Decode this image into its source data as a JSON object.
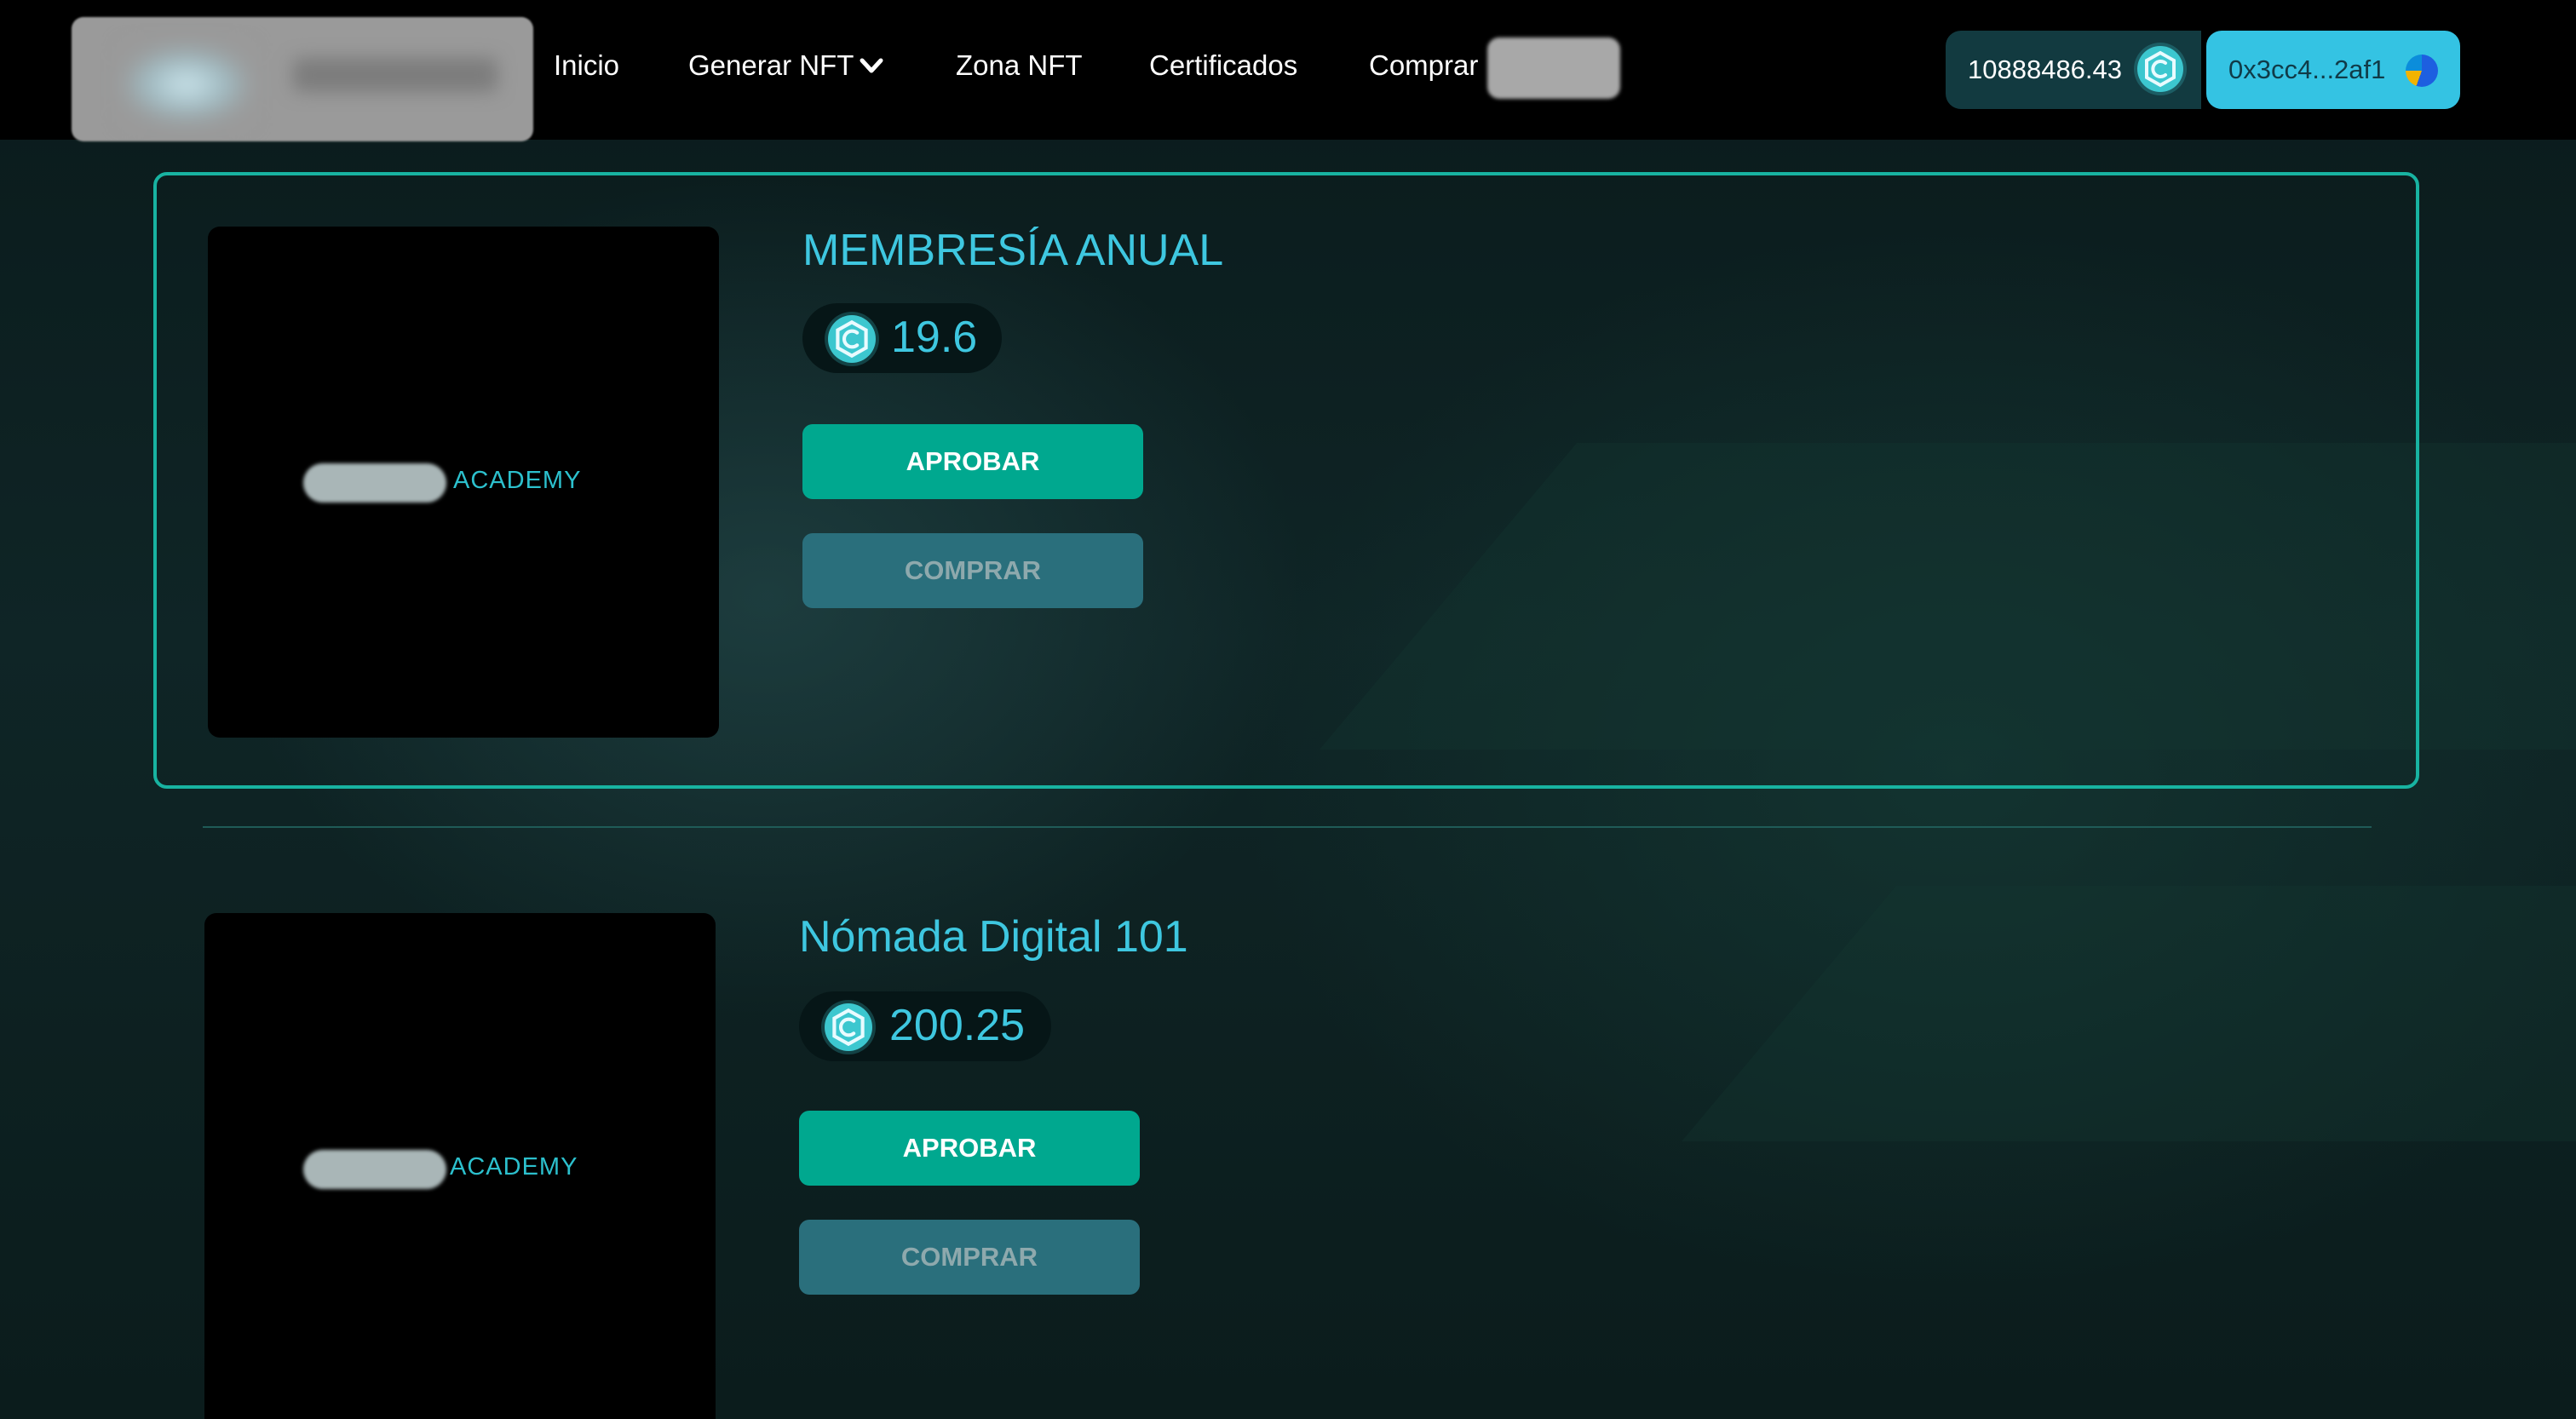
{
  "header": {
    "logo_alt": "logo",
    "nav": [
      {
        "label": "Inicio"
      },
      {
        "label": "Generar NFT"
      },
      {
        "label": "Zona NFT"
      },
      {
        "label": "Certificados"
      },
      {
        "label": "Comprar"
      }
    ],
    "balance": "10888486.43",
    "wallet_address": "0x3cc4...2af1"
  },
  "products": [
    {
      "thumb_label": "ACADEMY",
      "title": "MEMBRESÍA ANUAL",
      "price": "19.6",
      "approve_label": "APROBAR",
      "buy_label": "COMPRAR"
    },
    {
      "thumb_label": "ACADEMY",
      "title": "Nómada Digital 101",
      "price": "200.25",
      "approve_label": "APROBAR",
      "buy_label": "COMPRAR"
    }
  ],
  "colors": {
    "accent": "#3ec7e0",
    "approve": "#00a88f",
    "buy_disabled": "#2a6f7c",
    "card_border": "#18b3a1"
  },
  "icons": {
    "coin": "coin-icon",
    "chevron": "chevron-down-icon",
    "avatar": "wallet-avatar-icon"
  }
}
